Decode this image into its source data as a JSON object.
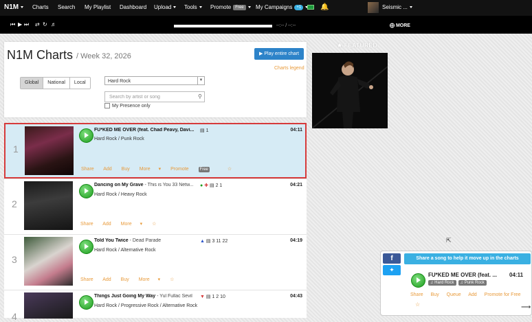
{
  "nav": {
    "brand": "N1M",
    "items": [
      "Charts",
      "Search",
      "My Playlist",
      "Dashboard",
      "Upload",
      "Tools",
      "Promote",
      "My Campaigns"
    ],
    "promote_badge": "Free",
    "campaigns_badge": "+1",
    "username": "Seismic ..."
  },
  "player": {
    "time": "--:-- / --:--",
    "more_label": "MORE"
  },
  "header": {
    "title": "N1M Charts",
    "subtitle": "/ Week 32, 2026",
    "play_entire": "Play entire chart",
    "legend_link": "Charts legend",
    "scope_tabs": [
      "Global",
      "National",
      "Local"
    ],
    "active_scope": "Global",
    "genre_selected": "Hard Rock",
    "search_placeholder": "Search by artist or song",
    "presence_label": "My Presence only"
  },
  "featured_label": "FEATURED",
  "rows": [
    {
      "rank": "1",
      "title": "FU*KED ME OVER (feat. Chad Peavy, Davi...",
      "artist": "",
      "genres": "Hard Rock / Punk Rock",
      "stats": "1",
      "duration": "04:11",
      "actions": [
        "Share",
        "Add",
        "Buy",
        "More",
        "Promote"
      ],
      "promote_badge": "Free",
      "selected": true
    },
    {
      "rank": "2",
      "title": "Dancing on My Grave",
      "artist": " - This is You 33 Netw...",
      "genres": "Hard Rock / Heavy Rock",
      "stats": "2   1",
      "duration": "04:21",
      "actions": [
        "Share",
        "Add",
        "More"
      ],
      "selected": false
    },
    {
      "rank": "3",
      "title": "Told You Twice",
      "artist": " - Dead Parade",
      "genres": "Hard Rock / Alternative Rock",
      "stats": "3   11   22",
      "duration": "04:19",
      "actions": [
        "Share",
        "Add",
        "Buy",
        "More"
      ],
      "selected": false
    },
    {
      "rank": "4",
      "title": "Things Just Going My Way",
      "artist": " - Yul Fullac Sevil",
      "genres": "Hard Rock / Progressive Rock / Alternative Rock",
      "stats": "1   2   10",
      "duration": "04:43",
      "actions": [],
      "selected": false
    }
  ],
  "share_widget": {
    "message": "Share a song to help it move up in the charts",
    "song_title": "FU*KED ME OVER (feat. ...",
    "duration": "04:11",
    "tags": [
      "Hard Rock",
      "Punk Rock"
    ],
    "actions": [
      "Share",
      "Buy",
      "Queue",
      "Add",
      "Promote for Free"
    ]
  }
}
